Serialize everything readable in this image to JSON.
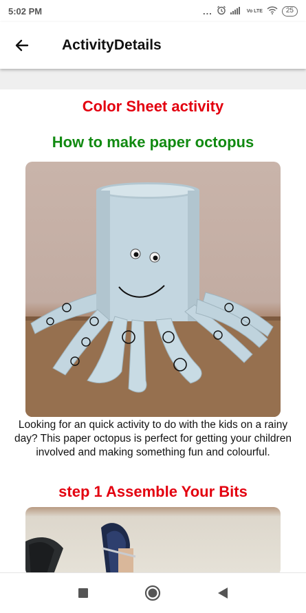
{
  "status_bar": {
    "time": "5:02 PM",
    "dots": "...",
    "network_label": "Vo LTE",
    "battery": "25"
  },
  "app_bar": {
    "title": "ActivityDetails",
    "back_icon": "arrow-left-icon"
  },
  "content": {
    "category_heading": "Color Sheet activity",
    "activity_title": "How to make paper octopus",
    "description": "Looking for an quick activity to do with the kids on a rainy day? This paper octopus is perfect for getting your children involved and making something fun and colourful.",
    "step_heading": "step 1 Assemble Your Bits"
  },
  "colors": {
    "red_heading": "#e3000f",
    "green_heading": "#118a11",
    "octopus_paper": "#bfd3dd"
  },
  "nav_bar": {
    "icons": [
      "recents-square-icon",
      "home-circle-icon",
      "back-triangle-icon"
    ]
  }
}
